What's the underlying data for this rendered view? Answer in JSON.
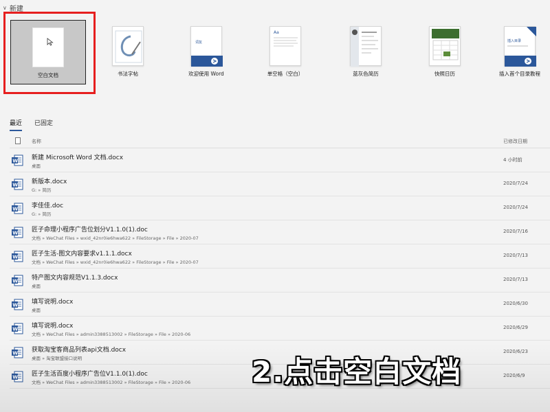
{
  "new_section": {
    "title": "新建"
  },
  "templates": [
    {
      "label": "空白文档",
      "icon": "blank-document-icon"
    },
    {
      "label": "书法字帖",
      "icon": "calligraphy-icon"
    },
    {
      "label": "欢迎使用 Word",
      "icon": "welcome-word-icon"
    },
    {
      "label": "单空格（空白）",
      "icon": "single-spaced-icon"
    },
    {
      "label": "蓝灰色简历",
      "icon": "resume-icon"
    },
    {
      "label": "快照日历",
      "icon": "calendar-icon"
    },
    {
      "label": "插入首个目录教程",
      "icon": "toc-tutorial-icon"
    }
  ],
  "tabs": [
    {
      "label": "最近",
      "active": true
    },
    {
      "label": "已固定",
      "active": false
    }
  ],
  "table": {
    "col_name": "名称",
    "col_date": "已修改日期",
    "rows": [
      {
        "name": "新建 Microsoft Word 文档.docx",
        "path": "桌面",
        "date": "4 小时前"
      },
      {
        "name": "新版本.docx",
        "path": "G: » 简历",
        "date": "2020/7/24"
      },
      {
        "name": "李佳佳.doc",
        "path": "G: » 简历",
        "date": "2020/7/24"
      },
      {
        "name": "匠子命理小程序广告位划分V1.1.0(1).doc",
        "path": "文档 » WeChat Files » wxid_42nr0ie6hwa622 » FileStorage » File » 2020-07",
        "date": "2020/7/16"
      },
      {
        "name": "匠子生活-图文内容要求v1.1.1.docx",
        "path": "文档 » WeChat Files » wxid_42nr0ie6hwa622 » FileStorage » File » 2020-07",
        "date": "2020/7/13"
      },
      {
        "name": "特产图文内容规范V1.1.3.docx",
        "path": "桌面",
        "date": "2020/7/13"
      },
      {
        "name": "填写说明.docx",
        "path": "桌面",
        "date": "2020/6/30"
      },
      {
        "name": "填写说明.docx",
        "path": "文档 » WeChat Files » admin3388513002 » FileStorage » File » 2020-06",
        "date": "2020/6/29"
      },
      {
        "name": "获取淘宝客商品列表api文档.docx",
        "path": "桌面 » 淘宝联盟接口说明",
        "date": "2020/6/23"
      },
      {
        "name": "匠子生活百度小程序广告位V1.1.0(1).doc",
        "path": "文档 » WeChat Files » admin3388513002 » FileStorage » File » 2020-06",
        "date": "2020/6/9"
      }
    ]
  },
  "caption": "2.点击空白文档",
  "colors": {
    "highlight": "#e61e1e",
    "word_blue": "#2b579a",
    "background": "#f3f3f3"
  }
}
